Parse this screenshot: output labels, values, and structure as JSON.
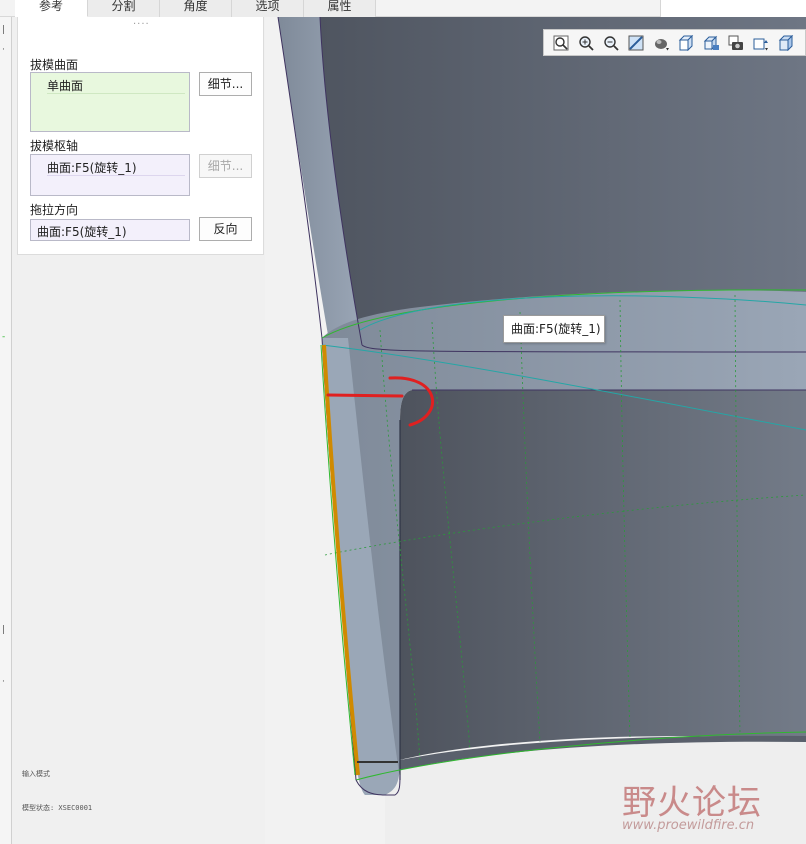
{
  "tabs": [
    {
      "label": "参考",
      "active": true
    },
    {
      "label": "分割",
      "active": false
    },
    {
      "label": "角度",
      "active": false
    },
    {
      "label": "选项",
      "active": false
    },
    {
      "label": "属性",
      "active": false
    }
  ],
  "panel": {
    "grip": "····",
    "draft_surfaces_label": "拔模曲面",
    "draft_surfaces_value": "单曲面",
    "draft_hinges_label": "拔模枢轴",
    "draft_hinges_value": "曲面:F5(旋转_1)",
    "pull_direction_label": "拖拉方向",
    "pull_direction_value": "曲面:F5(旋转_1)",
    "details_button": "细节...",
    "details_button_2": "细节...",
    "flip_button": "反向"
  },
  "tooltip": "曲面:F5(旋转_1)",
  "status": {
    "line1": "输入模式",
    "line2": "模型状态: XSEC0001"
  },
  "watermark": {
    "title": "野火论坛",
    "url": "www.proewildfire.cn"
  },
  "toolbar_icons": [
    "zoom-to-fit-icon",
    "zoom-in-icon",
    "zoom-out-icon",
    "repaint-icon",
    "display-style-icon",
    "named-views-icon",
    "saved-orientations-icon",
    "view-manager-icon",
    "spin-center-icon",
    "datum-display-icon"
  ],
  "colors": {
    "surface": "#8d9aab",
    "surface_dark": "#5a606c",
    "edge_highlight": "#d08a00",
    "green_edge": "#2fb82f",
    "sketch_red": "#e02020",
    "accent_panel": "#e8f8de"
  }
}
